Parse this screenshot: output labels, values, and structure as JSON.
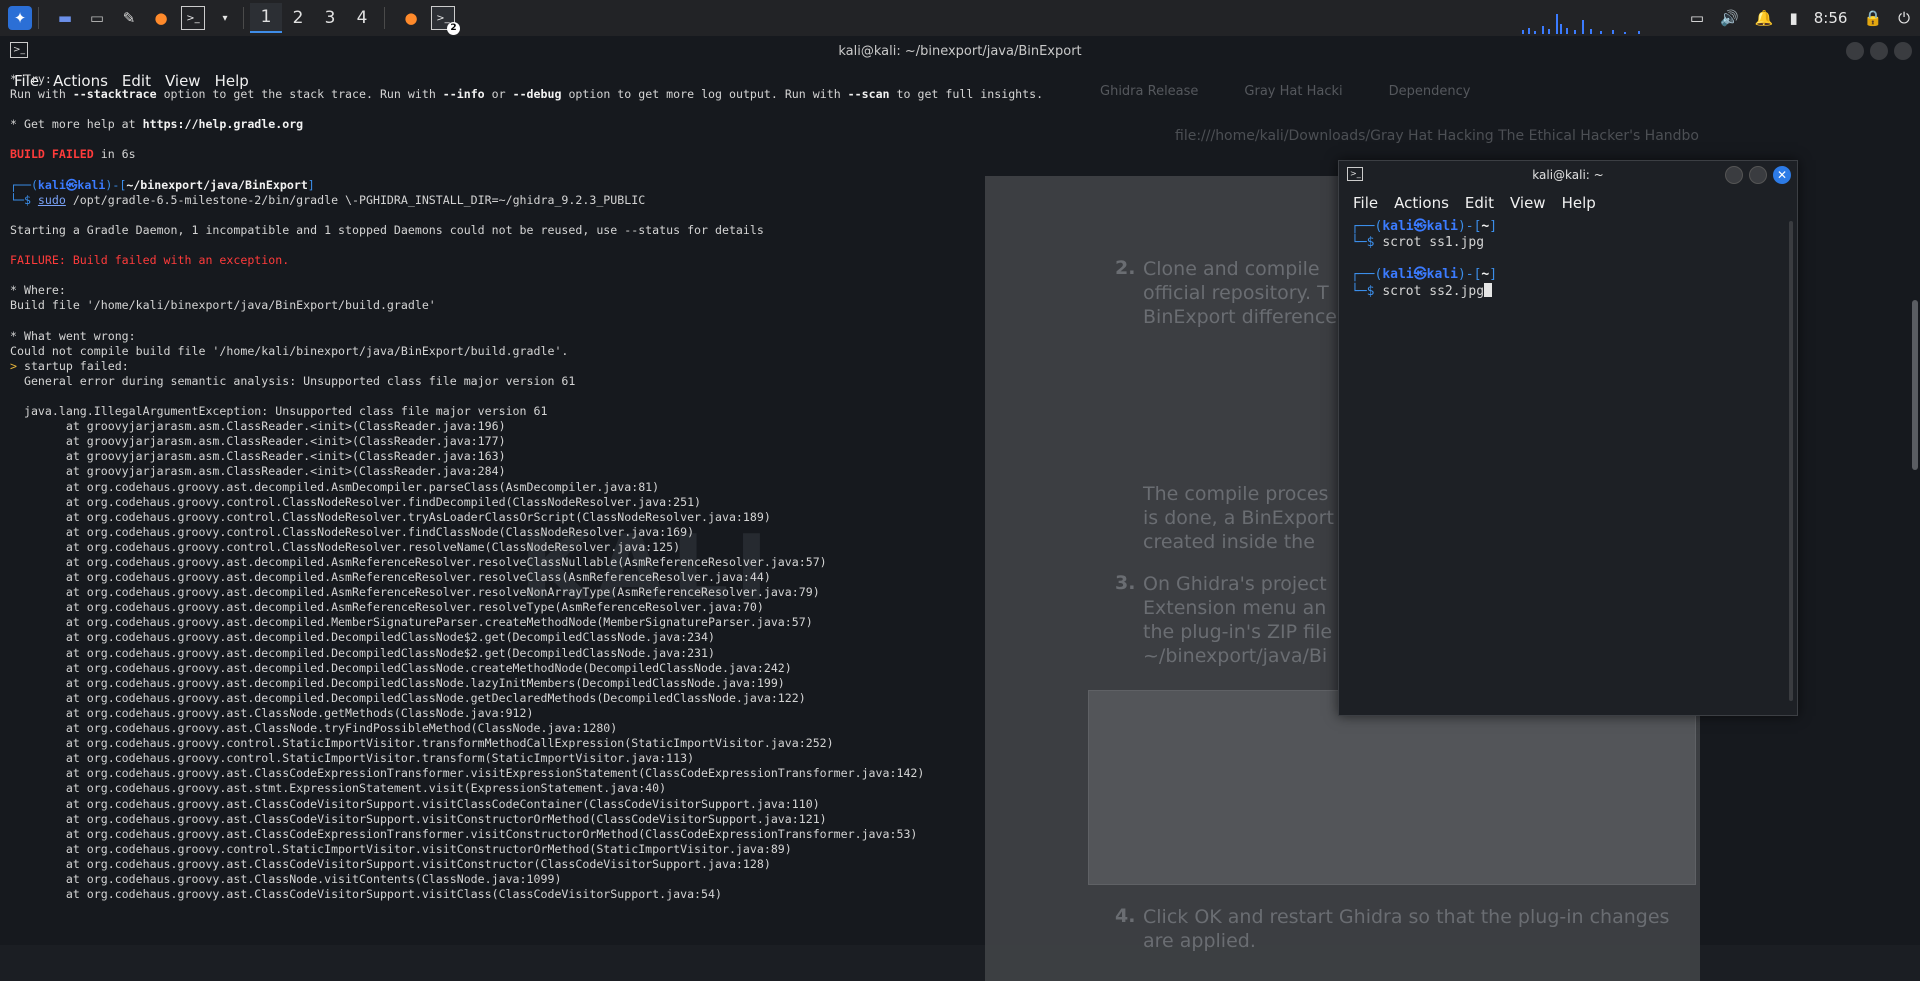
{
  "taskbar": {
    "workspaces": [
      "1",
      "2",
      "3",
      "4"
    ],
    "active_workspace": "1",
    "terminal_badge": "2",
    "clock": "8:56"
  },
  "bg_terminal": {
    "title": "kali@kali: ~/binexport/java/BinExport",
    "menu": [
      "File",
      "Actions",
      "Edit",
      "View",
      "Help"
    ],
    "lines": {
      "try": "* Try:",
      "run_with_a": "Run with ",
      "stacktrace": "--stacktrace",
      "run_with_b": " option to get the stack trace. Run with ",
      "info": "--info",
      "or": " or ",
      "debug": "--debug",
      "run_with_c": " option to get more log output. Run with ",
      "scan": "--scan",
      "run_with_d": " to get full insights.",
      "help_a": "* Get more help at ",
      "help_url": "https://help.gradle.org",
      "build_failed": "BUILD FAILED",
      "build_time": " in 6s",
      "prompt_user": "kali㉿kali",
      "prompt_path": "~/binexport/java/BinExport",
      "sudo": "sudo",
      "cmd": " /opt/gradle-6.5-milestone-2/bin/gradle \\-PGHIDRA_INSTALL_DIR=~/ghidra_9.2.3_PUBLIC",
      "daemon": "Starting a Gradle Daemon, 1 incompatible and 1 stopped Daemons could not be reused, use --status for details",
      "failure": "FAILURE: Build failed with an exception.",
      "where": "* Where:",
      "build_file": "Build file '/home/kali/binexport/java/BinExport/build.gradle'",
      "wrong": "* What went wrong:",
      "compile": "Could not compile build file '/home/kali/binexport/java/BinExport/build.gradle'.",
      "startup": "startup failed:",
      "general": "  General error during semantic analysis: Unsupported class file major version 61",
      "exception": "  java.lang.IllegalArgumentException: Unsupported class file major version 61"
    },
    "stack": [
      "at groovyjarjarasm.asm.ClassReader.<init>(ClassReader.java:196)",
      "at groovyjarjarasm.asm.ClassReader.<init>(ClassReader.java:177)",
      "at groovyjarjarasm.asm.ClassReader.<init>(ClassReader.java:163)",
      "at groovyjarjarasm.asm.ClassReader.<init>(ClassReader.java:284)",
      "at org.codehaus.groovy.ast.decompiled.AsmDecompiler.parseClass(AsmDecompiler.java:81)",
      "at org.codehaus.groovy.control.ClassNodeResolver.findDecompiled(ClassNodeResolver.java:251)",
      "at org.codehaus.groovy.control.ClassNodeResolver.tryAsLoaderClassOrScript(ClassNodeResolver.java:189)",
      "at org.codehaus.groovy.control.ClassNodeResolver.findClassNode(ClassNodeResolver.java:169)",
      "at org.codehaus.groovy.control.ClassNodeResolver.resolveName(ClassNodeResolver.java:125)",
      "at org.codehaus.groovy.ast.decompiled.AsmReferenceResolver.resolveClassNullable(AsmReferenceResolver.java:57)",
      "at org.codehaus.groovy.ast.decompiled.AsmReferenceResolver.resolveClass(AsmReferenceResolver.java:44)",
      "at org.codehaus.groovy.ast.decompiled.AsmReferenceResolver.resolveNonArrayType(AsmReferenceResolver.java:79)",
      "at org.codehaus.groovy.ast.decompiled.AsmReferenceResolver.resolveType(AsmReferenceResolver.java:70)",
      "at org.codehaus.groovy.ast.decompiled.MemberSignatureParser.createMethodNode(MemberSignatureParser.java:57)",
      "at org.codehaus.groovy.ast.decompiled.DecompiledClassNode$2.get(DecompiledClassNode.java:234)",
      "at org.codehaus.groovy.ast.decompiled.DecompiledClassNode$2.get(DecompiledClassNode.java:231)",
      "at org.codehaus.groovy.ast.decompiled.DecompiledClassNode.createMethodNode(DecompiledClassNode.java:242)",
      "at org.codehaus.groovy.ast.decompiled.DecompiledClassNode.lazyInitMembers(DecompiledClassNode.java:199)",
      "at org.codehaus.groovy.ast.decompiled.DecompiledClassNode.getDeclaredMethods(DecompiledClassNode.java:122)",
      "at org.codehaus.groovy.ast.ClassNode.getMethods(ClassNode.java:912)",
      "at org.codehaus.groovy.ast.ClassNode.tryFindPossibleMethod(ClassNode.java:1280)",
      "at org.codehaus.groovy.control.StaticImportVisitor.transformMethodCallExpression(StaticImportVisitor.java:252)",
      "at org.codehaus.groovy.control.StaticImportVisitor.transform(StaticImportVisitor.java:113)",
      "at org.codehaus.groovy.ast.ClassCodeExpressionTransformer.visitExpressionStatement(ClassCodeExpressionTransformer.java:142)",
      "at org.codehaus.groovy.ast.stmt.ExpressionStatement.visit(ExpressionStatement.java:40)",
      "at org.codehaus.groovy.ast.ClassCodeVisitorSupport.visitClassCodeContainer(ClassCodeVisitorSupport.java:110)",
      "at org.codehaus.groovy.ast.ClassCodeVisitorSupport.visitConstructorOrMethod(ClassCodeVisitorSupport.java:121)",
      "at org.codehaus.groovy.ast.ClassCodeExpressionTransformer.visitConstructorOrMethod(ClassCodeExpressionTransformer.java:53)",
      "at org.codehaus.groovy.control.StaticImportVisitor.visitConstructorOrMethod(StaticImportVisitor.java:89)",
      "at org.codehaus.groovy.ast.ClassCodeVisitorSupport.visitConstructor(ClassCodeVisitorSupport.java:128)",
      "at org.codehaus.groovy.ast.ClassNode.visitContents(ClassNode.java:1099)",
      "at org.codehaus.groovy.ast.ClassCodeVisitorSupport.visitClass(ClassCodeVisitorSupport.java:54)"
    ]
  },
  "fg_terminal": {
    "title": "kali@kali: ~",
    "menu": [
      "File",
      "Actions",
      "Edit",
      "View",
      "Help"
    ],
    "prompt_user": "kali㉿kali",
    "prompt_path": "~",
    "cmd1": "scrot ss1.jpg",
    "cmd2": "scrot ss2.jpg"
  },
  "background_doc": {
    "tabs": [
      "Ghidra Release",
      "Gray Hat Hacki",
      "Dependency"
    ],
    "url": "file:///home/kali/Downloads/Gray Hat Hacking The Ethical Hacker's Handbo",
    "step2": [
      "Clone and compile",
      "official repository. T",
      "BinExport difference"
    ],
    "step2_mid": [
      "The compile proces",
      "is done, a BinExport",
      "created inside the"
    ],
    "step3": [
      "On Ghidra's project",
      "Extension menu an",
      "the plug-in's ZIP file",
      "~/binexport/java/Bi"
    ],
    "step4": [
      "Click OK and restart Ghidra so that the plug-in changes",
      "are applied."
    ]
  },
  "colors": {
    "accent": "#3f8de8",
    "error": "#ff3b3b",
    "prompt": "#3b8eea"
  }
}
